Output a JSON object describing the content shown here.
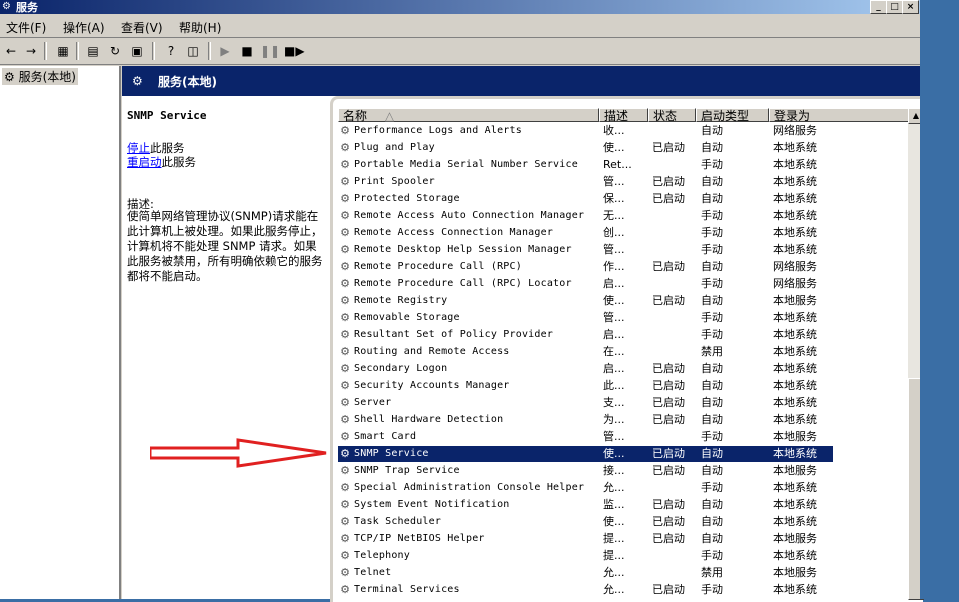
{
  "window": {
    "title": "服务"
  },
  "menu": [
    {
      "label": "文件(F)"
    },
    {
      "label": "操作(A)"
    },
    {
      "label": "查看(V)"
    },
    {
      "label": "帮助(H)"
    }
  ],
  "tree": {
    "root": "服务(本地)"
  },
  "header": {
    "title": "服务(本地)"
  },
  "description": {
    "service_name": "SNMP Service",
    "stop_link": "停止",
    "stop_rest": "此服务",
    "restart_link": "重启动",
    "restart_rest": "此服务",
    "label": "描述:",
    "text": "使简单网络管理协议(SNMP)请求能在此计算机上被处理。如果此服务停止，计算机将不能处理 SNMP 请求。如果此服务被禁用，所有明确依赖它的服务都将不能启动。"
  },
  "columns": {
    "name": "名称",
    "desc": "描述",
    "status": "状态",
    "start": "启动类型",
    "logon": "登录为"
  },
  "services": [
    {
      "name": "Performance Logs and Alerts",
      "desc": "收...",
      "status": "",
      "start": "自动",
      "logon": "网络服务"
    },
    {
      "name": "Plug and Play",
      "desc": "使...",
      "status": "已启动",
      "start": "自动",
      "logon": "本地系统"
    },
    {
      "name": "Portable Media Serial Number Service",
      "desc": "Ret...",
      "status": "",
      "start": "手动",
      "logon": "本地系统"
    },
    {
      "name": "Print Spooler",
      "desc": "管...",
      "status": "已启动",
      "start": "自动",
      "logon": "本地系统"
    },
    {
      "name": "Protected Storage",
      "desc": "保...",
      "status": "已启动",
      "start": "自动",
      "logon": "本地系统"
    },
    {
      "name": "Remote Access Auto Connection Manager",
      "desc": "无...",
      "status": "",
      "start": "手动",
      "logon": "本地系统"
    },
    {
      "name": "Remote Access Connection Manager",
      "desc": "创...",
      "status": "",
      "start": "手动",
      "logon": "本地系统"
    },
    {
      "name": "Remote Desktop Help Session Manager",
      "desc": "管...",
      "status": "",
      "start": "手动",
      "logon": "本地系统"
    },
    {
      "name": "Remote Procedure Call (RPC)",
      "desc": "作...",
      "status": "已启动",
      "start": "自动",
      "logon": "网络服务"
    },
    {
      "name": "Remote Procedure Call (RPC) Locator",
      "desc": "启...",
      "status": "",
      "start": "手动",
      "logon": "网络服务"
    },
    {
      "name": "Remote Registry",
      "desc": "使...",
      "status": "已启动",
      "start": "自动",
      "logon": "本地服务"
    },
    {
      "name": "Removable Storage",
      "desc": "管...",
      "status": "",
      "start": "手动",
      "logon": "本地系统"
    },
    {
      "name": "Resultant Set of Policy Provider",
      "desc": "启...",
      "status": "",
      "start": "手动",
      "logon": "本地系统"
    },
    {
      "name": "Routing and Remote Access",
      "desc": "在...",
      "status": "",
      "start": "禁用",
      "logon": "本地系统"
    },
    {
      "name": "Secondary Logon",
      "desc": "启...",
      "status": "已启动",
      "start": "自动",
      "logon": "本地系统"
    },
    {
      "name": "Security Accounts Manager",
      "desc": "此...",
      "status": "已启动",
      "start": "自动",
      "logon": "本地系统"
    },
    {
      "name": "Server",
      "desc": "支...",
      "status": "已启动",
      "start": "自动",
      "logon": "本地系统"
    },
    {
      "name": "Shell Hardware Detection",
      "desc": "为...",
      "status": "已启动",
      "start": "自动",
      "logon": "本地系统"
    },
    {
      "name": "Smart Card",
      "desc": "管...",
      "status": "",
      "start": "手动",
      "logon": "本地服务"
    },
    {
      "name": "SNMP Service",
      "desc": "使...",
      "status": "已启动",
      "start": "自动",
      "logon": "本地系统"
    },
    {
      "name": "SNMP Trap Service",
      "desc": "接...",
      "status": "已启动",
      "start": "自动",
      "logon": "本地服务"
    },
    {
      "name": "Special Administration Console Helper",
      "desc": "允...",
      "status": "",
      "start": "手动",
      "logon": "本地系统"
    },
    {
      "name": "System Event Notification",
      "desc": "监...",
      "status": "已启动",
      "start": "自动",
      "logon": "本地系统"
    },
    {
      "name": "Task Scheduler",
      "desc": "使...",
      "status": "已启动",
      "start": "自动",
      "logon": "本地系统"
    },
    {
      "name": "TCP/IP NetBIOS Helper",
      "desc": "提...",
      "status": "已启动",
      "start": "自动",
      "logon": "本地服务"
    },
    {
      "name": "Telephony",
      "desc": "提...",
      "status": "",
      "start": "手动",
      "logon": "本地系统"
    },
    {
      "name": "Telnet",
      "desc": "允...",
      "status": "",
      "start": "禁用",
      "logon": "本地服务"
    },
    {
      "name": "Terminal Services",
      "desc": "允...",
      "status": "已启动",
      "start": "手动",
      "logon": "本地系统"
    }
  ],
  "selected_index": 19,
  "colors": {
    "selection": "#0a246a",
    "annotation_arrow": "#e02020"
  }
}
